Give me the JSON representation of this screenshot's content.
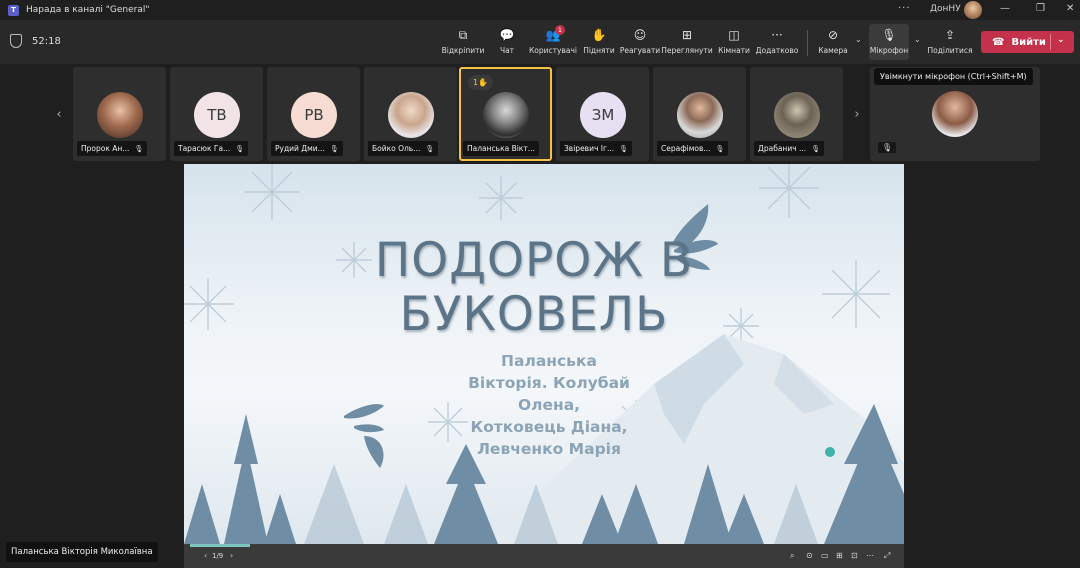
{
  "window": {
    "title": "Нарада в каналі \"General\"",
    "org": "ДонНУ",
    "more": "···",
    "minimize": "—",
    "restore": "❐",
    "close": "✕"
  },
  "toolbar": {
    "timer": "52:18",
    "items": [
      {
        "id": "share-tray",
        "label": "Відкріпити",
        "icon": "⧉"
      },
      {
        "id": "chat",
        "label": "Чат",
        "icon": "💬"
      },
      {
        "id": "people",
        "label": "Користувачі",
        "icon": "👥",
        "badge": "1"
      },
      {
        "id": "raise",
        "label": "Підняти",
        "icon": "✋"
      },
      {
        "id": "react",
        "label": "Реагувати",
        "icon": "☺"
      },
      {
        "id": "view",
        "label": "Переглянути",
        "icon": "⊞"
      },
      {
        "id": "rooms",
        "label": "Кімнати",
        "icon": "◫"
      },
      {
        "id": "apps",
        "label": "Додатково",
        "icon": "···"
      },
      {
        "id": "camera",
        "label": "Камера",
        "icon": "⊘"
      },
      {
        "id": "mic",
        "label": "Мікрофон",
        "icon": "🎙"
      },
      {
        "id": "share",
        "label": "Поділитися",
        "icon": "⇪"
      }
    ],
    "leave_label": "Вийти",
    "leave_icon": "☎",
    "dropdown": "⌄"
  },
  "participants": [
    {
      "name": "Пророк Ан...",
      "type": "photo"
    },
    {
      "name": "Тарасюк Га...",
      "type": "initials",
      "initials": "ТВ"
    },
    {
      "name": "Рудий Дми...",
      "type": "initials",
      "initials": "РВ"
    },
    {
      "name": "Бойко Оль...",
      "type": "photo"
    },
    {
      "name": "Паланська Вікт...",
      "type": "photo",
      "active": true,
      "hand": "1✋"
    },
    {
      "name": "Звіревич Іг...",
      "type": "initials",
      "initials": "ЗМ"
    },
    {
      "name": "Серафімов...",
      "type": "photo"
    },
    {
      "name": "Драбанич ...",
      "type": "photo"
    }
  ],
  "mic_icon": "🎙",
  "nav": {
    "prev": "‹",
    "next": "›"
  },
  "tooltip": "Увімкнути мікрофон (Ctrl+Shift+M)",
  "slide": {
    "title_line1": "ПОДОРОЖ В",
    "title_line2": "БУКОВЕЛЬ",
    "sub_lines": [
      "Паланська",
      "Вікторія. Колубай",
      "Олена,",
      "Котковець Діана,",
      "Левченко Марія"
    ],
    "page": "1/9"
  },
  "presenter_label": "Паланська Вікторія Миколаївна",
  "colors": {
    "leave": "#c4314b",
    "active_border": "#f5c142",
    "title": "#5c7488"
  }
}
